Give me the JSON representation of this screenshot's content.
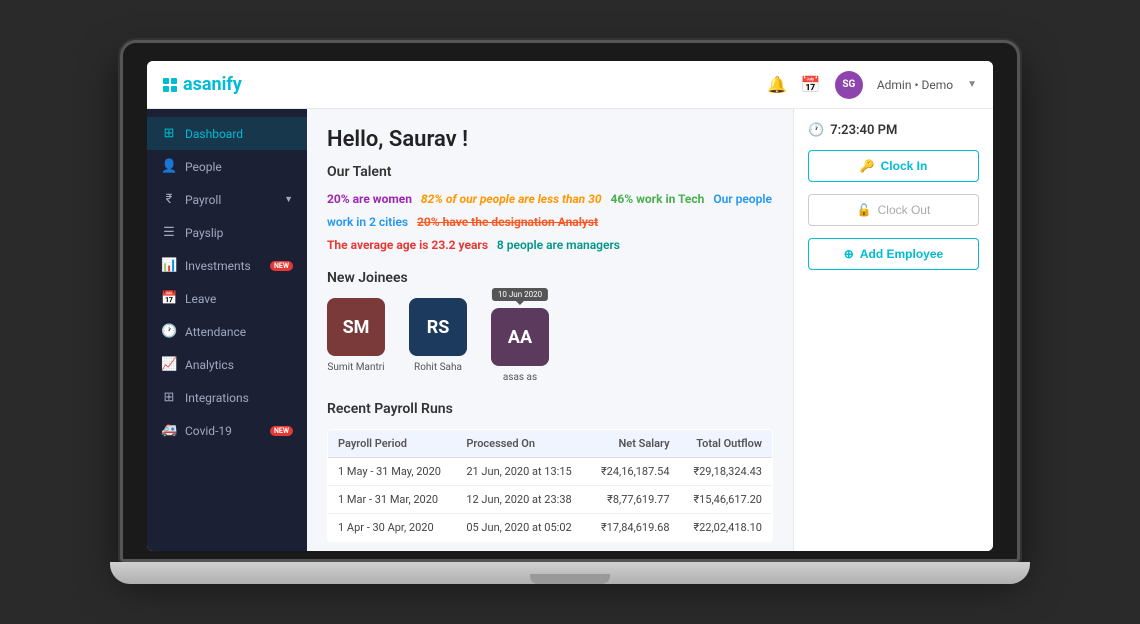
{
  "app": {
    "logo_text": "asanify",
    "admin_label": "Admin • Demo"
  },
  "sidebar": {
    "items": [
      {
        "id": "dashboard",
        "label": "Dashboard",
        "icon": "⊞",
        "active": true
      },
      {
        "id": "people",
        "label": "People",
        "icon": "👤",
        "active": false
      },
      {
        "id": "payroll",
        "label": "Payroll",
        "icon": "₹",
        "active": false,
        "has_chevron": true
      },
      {
        "id": "payslip",
        "label": "Payslip",
        "icon": "☰",
        "active": false
      },
      {
        "id": "investments",
        "label": "Investments",
        "icon": "📊",
        "active": false,
        "badge": "NEW"
      },
      {
        "id": "leave",
        "label": "Leave",
        "icon": "📅",
        "active": false
      },
      {
        "id": "attendance",
        "label": "Attendance",
        "icon": "🕐",
        "active": false
      },
      {
        "id": "analytics",
        "label": "Analytics",
        "icon": "📈",
        "active": false
      },
      {
        "id": "integrations",
        "label": "Integrations",
        "icon": "⊞",
        "active": false
      },
      {
        "id": "covid19",
        "label": "Covid-19",
        "icon": "🚑",
        "active": false,
        "badge": "NEW"
      }
    ]
  },
  "greeting": "Hello, Saurav !",
  "talent": {
    "title": "Our Talent",
    "stats": [
      {
        "text": "20% are women",
        "color": "women"
      },
      {
        "text": "82% of our people are less than 30",
        "color": "less30"
      },
      {
        "text": "46% work in Tech",
        "color": "workin"
      },
      {
        "text": "Our people work in 2 cities",
        "color": "cities"
      },
      {
        "text": "20% have the designation Analyst",
        "color": "analyst"
      },
      {
        "text": "The average age is 23.2 years",
        "color": "avgage"
      },
      {
        "text": "8 people are managers",
        "color": "managers"
      }
    ]
  },
  "new_joinees": {
    "title": "New Joinees",
    "items": [
      {
        "initials": "SM",
        "name": "Sumit Mantri",
        "bg": "#7b3a3a"
      },
      {
        "initials": "RS",
        "name": "Rohit Saha",
        "bg": "#1c3a5e"
      },
      {
        "initials": "AA",
        "name": "asas as",
        "bg": "#5c3a5e",
        "badge": "10 Jun 2020"
      }
    ]
  },
  "payroll": {
    "title": "Recent Payroll Runs",
    "headers": [
      "Payroll Period",
      "Processed On",
      "Net Salary",
      "Total Outflow"
    ],
    "rows": [
      {
        "period": "1 May - 31 May, 2020",
        "processed": "21 Jun, 2020 at 13:15",
        "net": "₹24,16,187.54",
        "outflow": "₹29,18,324.43"
      },
      {
        "period": "1 Mar - 31 Mar, 2020",
        "processed": "12 Jun, 2020 at 23:38",
        "net": "₹8,77,619.77",
        "outflow": "₹15,46,617.20"
      },
      {
        "period": "1 Apr - 30 Apr, 2020",
        "processed": "05 Jun, 2020 at 05:02",
        "net": "₹17,84,619.68",
        "outflow": "₹22,02,418.10"
      }
    ]
  },
  "right_panel": {
    "clock_time": "7:23:40 PM",
    "clock_in_label": "Clock In",
    "clock_out_label": "Clock Out",
    "add_employee_label": "Add Employee"
  }
}
